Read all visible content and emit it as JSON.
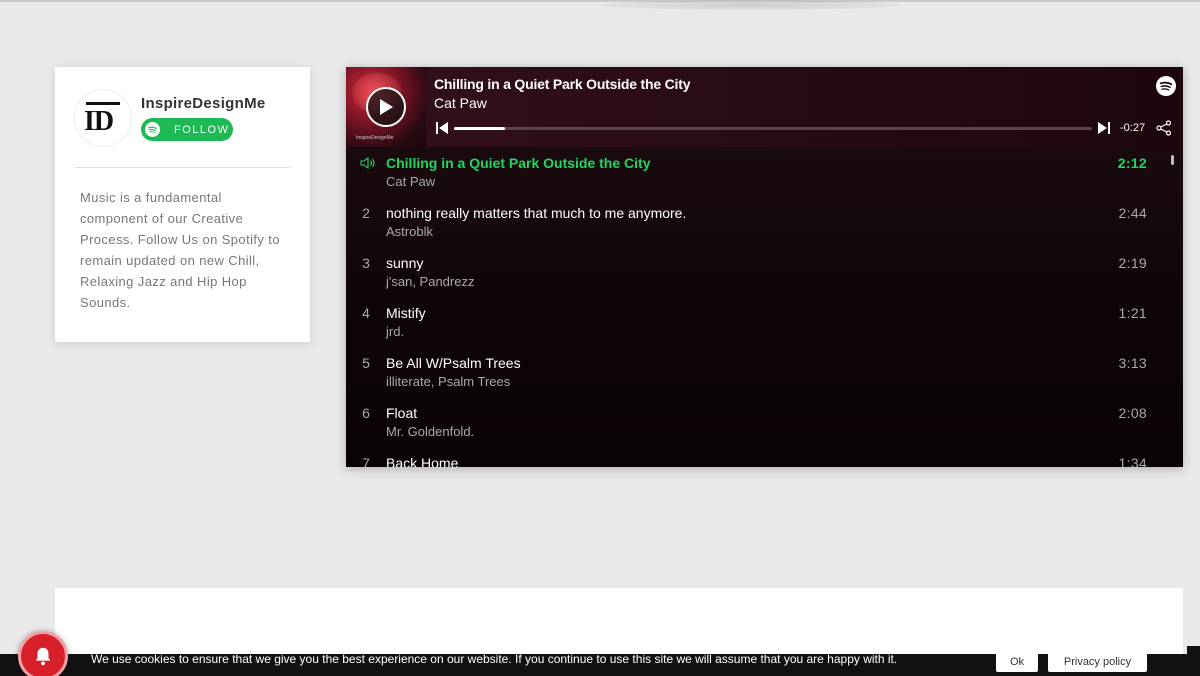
{
  "profile": {
    "avatar_text": "ID",
    "name": "InspireDesignMe",
    "follow_label": "FOLLOW",
    "description": "Music is a fundamental component of our Creative Process. Follow Us on Spotify to remain updated on new Chill, Relaxing Jazz and Hip Hop Sounds."
  },
  "player": {
    "cover_caption": "InspireDesignMe",
    "now_playing": {
      "title": "Chilling in a Quiet Park Outside the City",
      "artist": "Cat Paw",
      "progress": 0.08,
      "time_remaining": "-0:27"
    },
    "tracks": [
      {
        "num": "1",
        "title": "Chilling in a Quiet Park Outside the City",
        "artist": "Cat Paw",
        "duration": "2:12",
        "active": true
      },
      {
        "num": "2",
        "title": "nothing really matters that much to me anymore.",
        "artist": "Astroblk",
        "duration": "2:44"
      },
      {
        "num": "3",
        "title": "sunny",
        "artist": "j'san, Pandrezz",
        "duration": "2:19"
      },
      {
        "num": "4",
        "title": "Mistify",
        "artist": "jrd.",
        "duration": "1:21"
      },
      {
        "num": "5",
        "title": "Be All W/Psalm Trees",
        "artist": "illiterate, Psalm Trees",
        "duration": "3:13"
      },
      {
        "num": "6",
        "title": "Float",
        "artist": "Mr. Goldenfold.",
        "duration": "2:08"
      },
      {
        "num": "7",
        "title": "Back Home",
        "artist": "",
        "duration": "1:34"
      }
    ]
  },
  "cookie": {
    "text": "We use cookies to ensure that we give you the best experience on our website. If you continue to use this site we will assume that you are happy with it.",
    "ok_label": "Ok",
    "privacy_label": "Privacy policy"
  },
  "colors": {
    "spotify_green": "#1db954",
    "active_track": "#1ed760",
    "notification_red": "#d8202a"
  },
  "icons": [
    "spotify-icon",
    "play-icon",
    "previous-icon",
    "next-icon",
    "share-icon",
    "speaker-icon",
    "bell-icon"
  ]
}
